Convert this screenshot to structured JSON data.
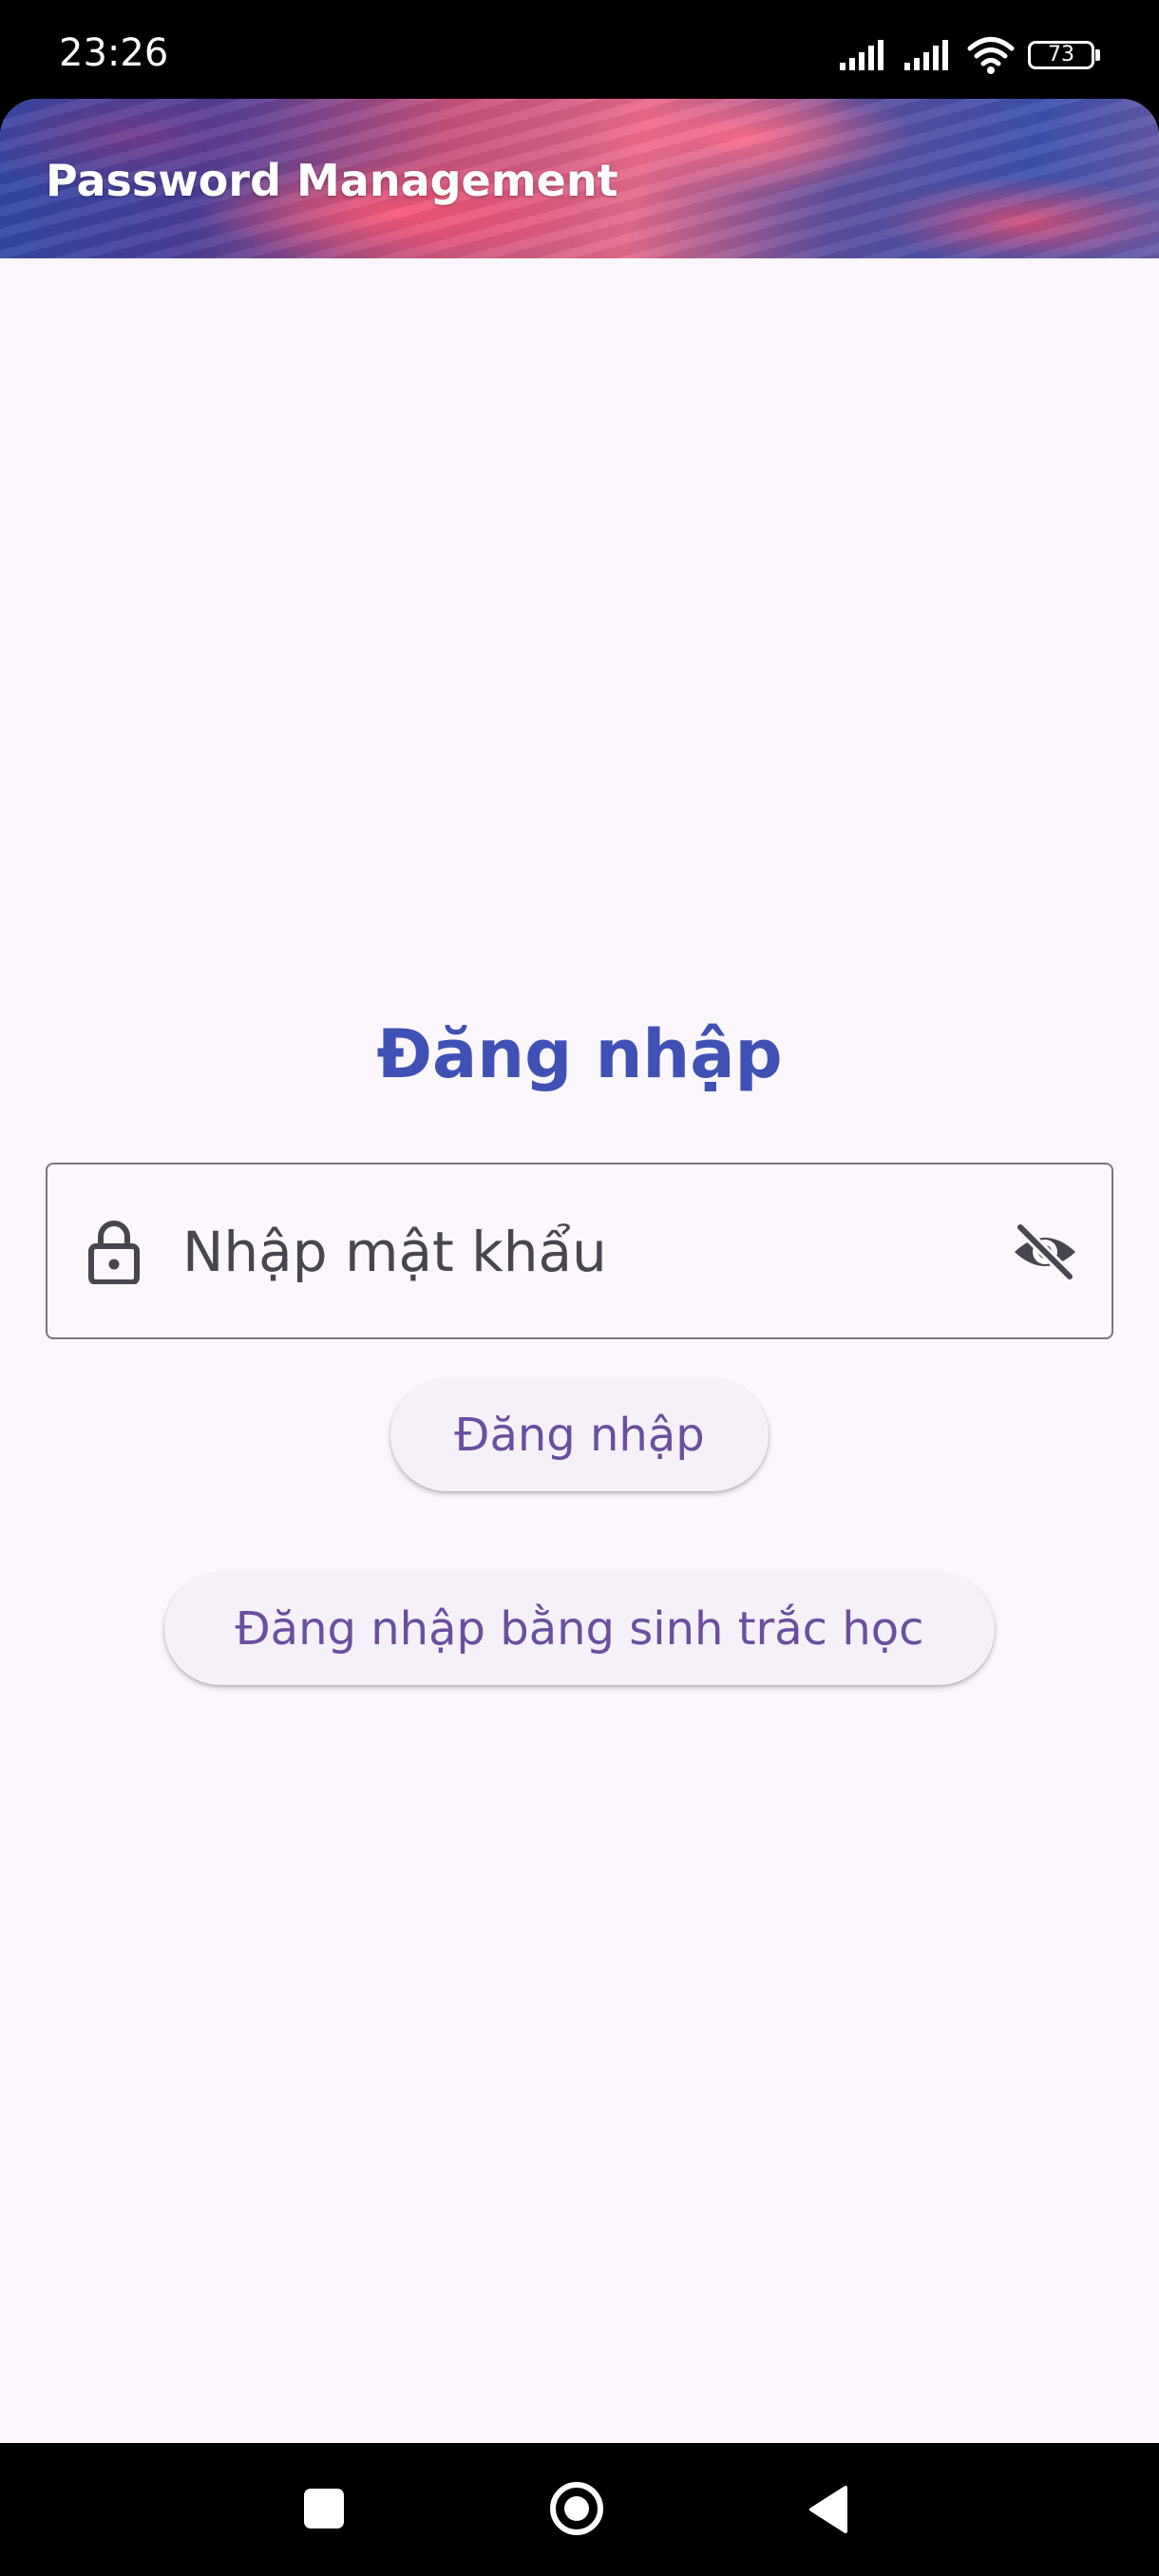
{
  "status_bar": {
    "time": "23:26",
    "battery_level": "73",
    "icons": [
      "signal-icon",
      "signal-icon",
      "wifi-icon",
      "battery-icon"
    ]
  },
  "app_bar": {
    "title": "Password Management"
  },
  "login": {
    "heading": "Đăng nhập",
    "password_placeholder": "Nhập mật khẩu",
    "password_value": "",
    "login_button_label": "Đăng nhập",
    "biometric_button_label": "Đăng nhập bằng sinh trắc học",
    "leading_icon": "lock-icon",
    "trailing_icon": "visibility-off-icon"
  },
  "nav_bar": {
    "icons": [
      "recent-apps-icon",
      "home-icon",
      "back-icon"
    ]
  },
  "colors": {
    "heading": "#3f51b5",
    "button_text": "#6a4fa0",
    "background": "#fbf7fd",
    "outline": "#79747e"
  }
}
